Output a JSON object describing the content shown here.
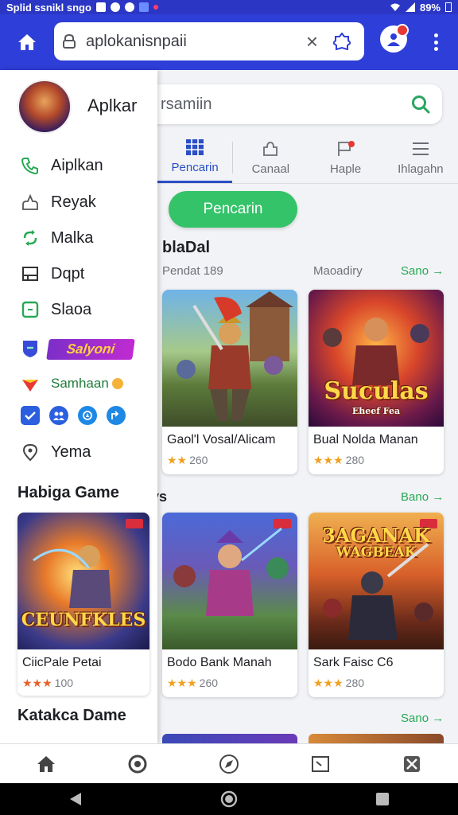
{
  "status_bar": {
    "title": "Splid ssnikl sngo",
    "battery": "89%"
  },
  "browser": {
    "url": "aplokanisnpaii",
    "clear_symbol": "×"
  },
  "drawer": {
    "username": "Aplkar",
    "items": [
      {
        "label": "Aiplkan",
        "icon": "phone-icon"
      },
      {
        "label": "Reyak",
        "icon": "profile-icon"
      },
      {
        "label": "Malka",
        "icon": "refresh-icon"
      },
      {
        "label": "Dqpt",
        "icon": "window-icon"
      },
      {
        "label": "Slaoa",
        "icon": "square-icon"
      }
    ],
    "tag_label": "Salyoni",
    "promo_label": "Samhaan",
    "last_item": {
      "label": "Yema",
      "icon": "location-icon"
    },
    "section_title": "Habiga Game",
    "card": {
      "art_title": "CEUNFKLES",
      "name": "CiicPale Petai",
      "stars": "★★★",
      "rating": "100"
    },
    "section2_title": "Katakca Dame"
  },
  "search": {
    "text": "rsamiin"
  },
  "tabs": [
    {
      "label": "Pencarin",
      "icon": "grid-icon",
      "active": true
    },
    {
      "label": "Canaal",
      "icon": "puzzle-icon",
      "active": false
    },
    {
      "label": "Haple",
      "icon": "flag-icon",
      "active": false
    },
    {
      "label": "Ihlagahn",
      "icon": "menu-icon",
      "active": false
    }
  ],
  "main_pill": "Pencarin",
  "section1": {
    "title": "blaDal",
    "sub_left": "Pendat 189",
    "sub_right": "Maoadiry",
    "see_more": "Sano →"
  },
  "section2": {
    "title": "ys",
    "see_more": "Bano →"
  },
  "section3": {
    "see_more": "Sano →"
  },
  "cards": [
    {
      "name": "Gaol'l Vosal/Alicam",
      "stars": "★★",
      "rating": "260"
    },
    {
      "name": "Bual Nolda Manan",
      "stars": "★★★",
      "rating": "280",
      "art_title": "Suculas",
      "art_sub": "Eheef Fea"
    },
    {
      "name": "Bodo Bank Manah",
      "stars": "★★★",
      "rating": "260"
    },
    {
      "name": "Sark Faisc C6",
      "stars": "★★★",
      "rating": "280",
      "art_title": "3AGANAK",
      "art_sub": "WAGBEAK"
    }
  ]
}
